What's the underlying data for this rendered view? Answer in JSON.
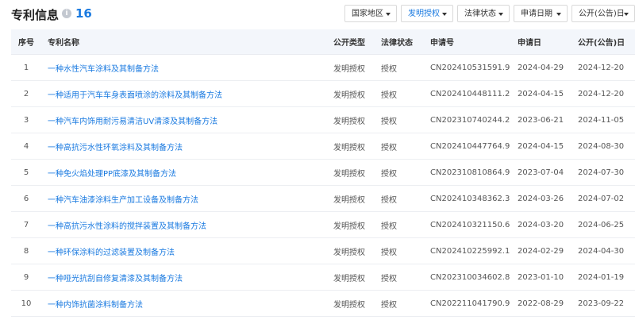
{
  "header": {
    "title": "专利信息",
    "info_icon": "i",
    "count": "16"
  },
  "filters": [
    {
      "label": "国家地区",
      "active": false
    },
    {
      "label": "发明授权",
      "active": true
    },
    {
      "label": "法律状态",
      "active": false
    },
    {
      "label": "申请日期",
      "active": false
    },
    {
      "label": "公开(公告)日",
      "active": false
    }
  ],
  "columns": {
    "index": "序号",
    "name": "专利名称",
    "pub_type": "公开类型",
    "legal_status": "法律状态",
    "app_no": "申请号",
    "app_date": "申请日",
    "pub_date": "公开(公告)日"
  },
  "rows": [
    {
      "index": "1",
      "name": "一种水性汽车涂料及其制备方法",
      "pub_type": "发明授权",
      "legal_status": "授权",
      "app_no": "CN202410531591.9",
      "app_date": "2024-04-29",
      "pub_date": "2024-12-20"
    },
    {
      "index": "2",
      "name": "一种适用于汽车车身表面喷涂的涂料及其制备方法",
      "pub_type": "发明授权",
      "legal_status": "授权",
      "app_no": "CN202410448111.2",
      "app_date": "2024-04-15",
      "pub_date": "2024-12-20"
    },
    {
      "index": "3",
      "name": "一种汽车内饰用耐污易清洁UV清漆及其制备方法",
      "pub_type": "发明授权",
      "legal_status": "授权",
      "app_no": "CN202310740244.2",
      "app_date": "2023-06-21",
      "pub_date": "2024-11-05"
    },
    {
      "index": "4",
      "name": "一种高抗污水性环氧涂料及其制备方法",
      "pub_type": "发明授权",
      "legal_status": "授权",
      "app_no": "CN202410447764.9",
      "app_date": "2024-04-15",
      "pub_date": "2024-08-30"
    },
    {
      "index": "5",
      "name": "一种免火焰处理PP底漆及其制备方法",
      "pub_type": "发明授权",
      "legal_status": "授权",
      "app_no": "CN202310810864.9",
      "app_date": "2023-07-04",
      "pub_date": "2024-07-30"
    },
    {
      "index": "6",
      "name": "一种汽车油漆涂料生产加工设备及制备方法",
      "pub_type": "发明授权",
      "legal_status": "授权",
      "app_no": "CN202410348362.3",
      "app_date": "2024-03-26",
      "pub_date": "2024-07-02"
    },
    {
      "index": "7",
      "name": "一种高抗污水性涂料的搅拌装置及其制备方法",
      "pub_type": "发明授权",
      "legal_status": "授权",
      "app_no": "CN202410321150.6",
      "app_date": "2024-03-20",
      "pub_date": "2024-06-25"
    },
    {
      "index": "8",
      "name": "一种环保涂料的过滤装置及制备方法",
      "pub_type": "发明授权",
      "legal_status": "授权",
      "app_no": "CN202410225992.1",
      "app_date": "2024-02-29",
      "pub_date": "2024-04-30"
    },
    {
      "index": "9",
      "name": "一种哑光抗刮自修复清漆及其制备方法",
      "pub_type": "发明授权",
      "legal_status": "授权",
      "app_no": "CN202310034602.8",
      "app_date": "2023-01-10",
      "pub_date": "2024-01-19"
    },
    {
      "index": "10",
      "name": "一种内饰抗菌涂料制备方法",
      "pub_type": "发明授权",
      "legal_status": "授权",
      "app_no": "CN202211041790.9",
      "app_date": "2022-08-29",
      "pub_date": "2023-09-22"
    }
  ],
  "colors": {
    "accent": "#1a7ae0",
    "header_bg": "#f3f6fb"
  }
}
